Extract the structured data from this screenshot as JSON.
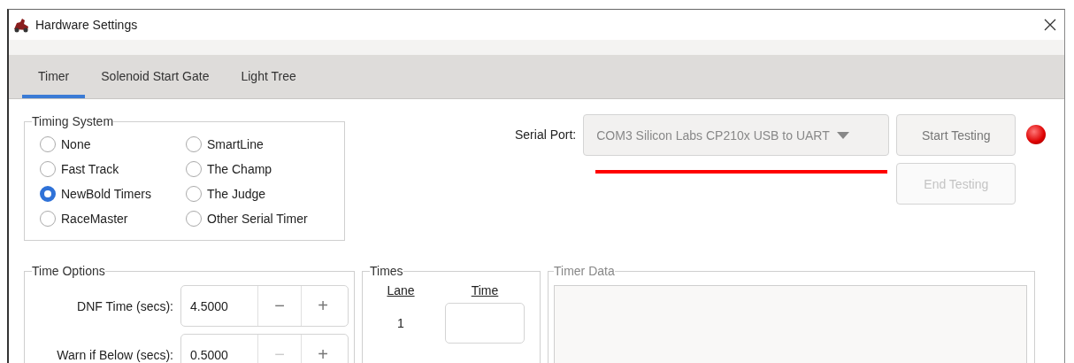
{
  "window": {
    "title": "Hardware Settings"
  },
  "tabs": [
    {
      "label": "Timer",
      "selected": true
    },
    {
      "label": "Solenoid Start Gate",
      "selected": false
    },
    {
      "label": "Light Tree",
      "selected": false
    }
  ],
  "timing_system": {
    "title": "Timing System",
    "options": [
      {
        "label": "None",
        "selected": false
      },
      {
        "label": "Fast Track",
        "selected": false
      },
      {
        "label": "NewBold Timers",
        "selected": true
      },
      {
        "label": "RaceMaster",
        "selected": false
      },
      {
        "label": "SmartLine",
        "selected": false
      },
      {
        "label": "The Champ",
        "selected": false
      },
      {
        "label": "The Judge",
        "selected": false
      },
      {
        "label": "Other Serial Timer",
        "selected": false
      }
    ]
  },
  "serial_port": {
    "label": "Serial Port:",
    "value": "COM3 Silicon Labs CP210x USB to UART",
    "disabled": true,
    "underlined": true
  },
  "buttons": [
    {
      "label": "Start Testing",
      "disabled": false
    },
    {
      "label": "End Testing",
      "disabled": true
    }
  ],
  "status_light": {
    "on": false
  },
  "time_options": {
    "title": "Time Options",
    "fields": [
      {
        "label": "DNF Time (secs):",
        "value": "4.5000",
        "minus": "−",
        "plus": "+",
        "minus_disabled": false
      },
      {
        "label": "Warn if Below (secs):",
        "value": "0.5000",
        "minus": "−",
        "plus": "+",
        "minus_disabled": true
      }
    ]
  },
  "times": {
    "title": "Times",
    "columns": [
      "Lane",
      "Time"
    ],
    "rows": [
      {
        "lane": "1"
      }
    ]
  },
  "timer_data": {
    "title": "Timer Data"
  }
}
